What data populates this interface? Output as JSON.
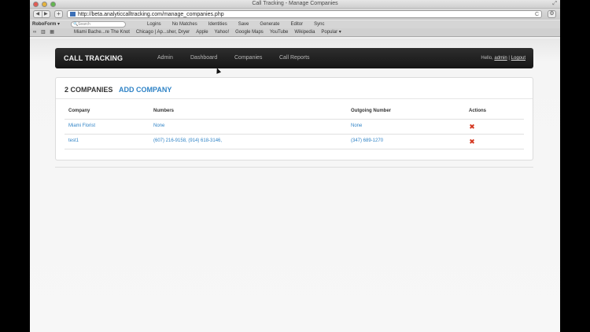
{
  "window": {
    "title": "Call Tracking - Manage Companies"
  },
  "toolbar": {
    "back": "◀",
    "forward": "▶",
    "new_tab": "+",
    "url": "http://beta.analyticcalltracking.com/manage_companies.php",
    "reload": "C",
    "settings": "⚙"
  },
  "roboform": {
    "label": "RoboForm ▾",
    "search_placeholder": "Search",
    "items": [
      "Logins",
      "No Matches",
      "Identities",
      "Save",
      "Generate",
      "Editor",
      "Sync"
    ]
  },
  "bookmarks": {
    "items": [
      "Miami Bache...re The Knot",
      "Chicago | Ap...sher, Dryer",
      "Apple",
      "Yahoo!",
      "Google Maps",
      "YouTube",
      "Wikipedia",
      "Popular ▾"
    ]
  },
  "app": {
    "brand": "CALL TRACKING",
    "nav": [
      {
        "label": "Admin",
        "active": true
      },
      {
        "label": "Dashboard",
        "active": false
      },
      {
        "label": "Companies",
        "active": false
      },
      {
        "label": "Call Reports",
        "active": false
      }
    ],
    "user": {
      "greeting": "Hello,",
      "name": "admin",
      "separator": "|",
      "logout": "Logout"
    }
  },
  "companies": {
    "heading": "2 COMPANIES",
    "add_label": "ADD COMPANY",
    "columns": [
      "Company",
      "Numbers",
      "Outgoing Number",
      "Actions"
    ],
    "rows": [
      {
        "company": "Miami Florist",
        "numbers": "None",
        "outgoing": "None"
      },
      {
        "company": "test1",
        "numbers": "(607) 216-9158, (914) 618-3146,",
        "outgoing": "(347) 689-1270"
      }
    ],
    "delete_glyph": "✖"
  }
}
